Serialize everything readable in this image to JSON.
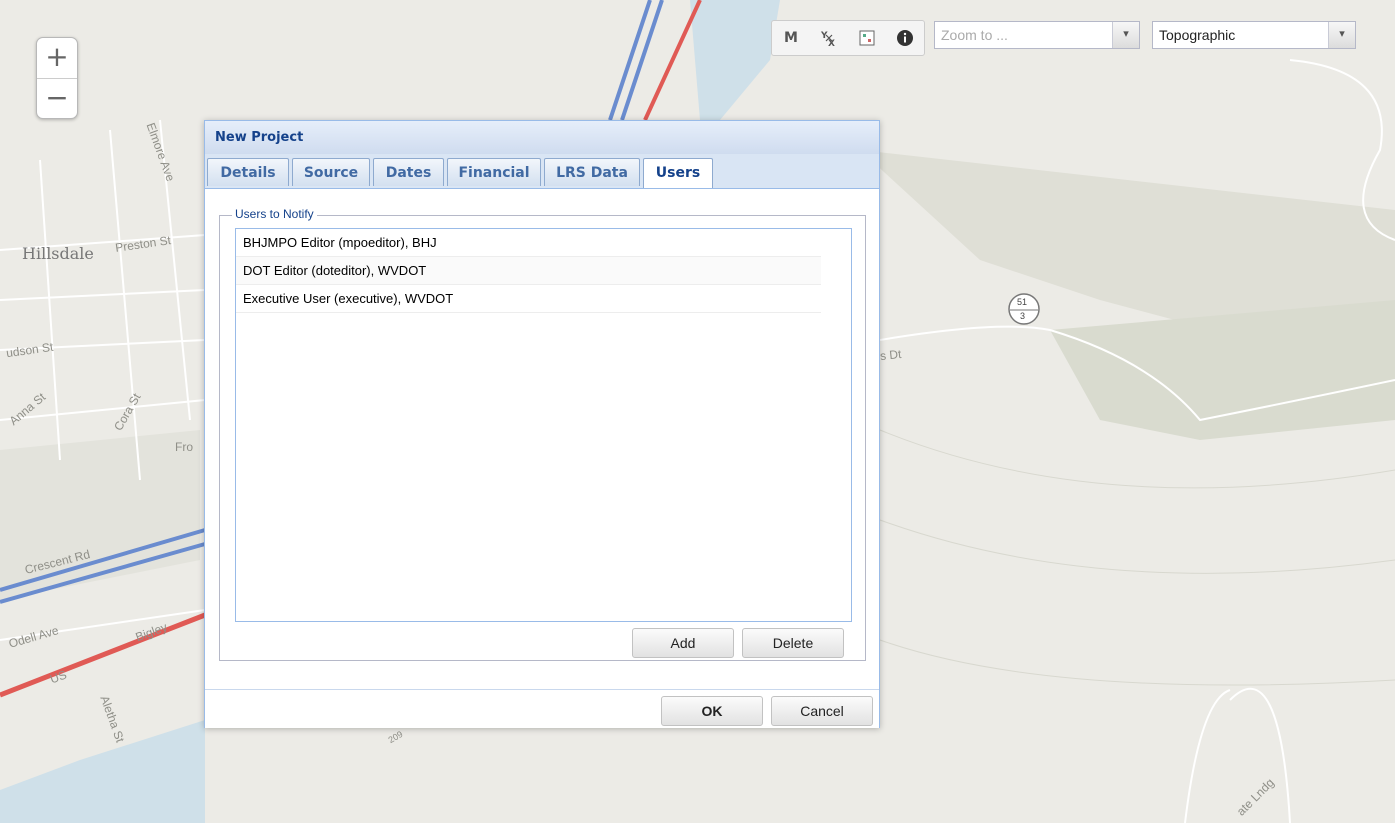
{
  "map": {
    "labels": {
      "hillsdale": "Hillsdale",
      "preston": "Preston St",
      "elmore": "Elmore Ave",
      "hudson": "udson St",
      "anna": "Anna St",
      "cora": "Cora St",
      "fro": "Fro",
      "crescent": "Crescent Rd",
      "odell": "Odell Ave",
      "us": "US",
      "bigley": "Bigley",
      "aletha": "Aletha St",
      "road_dt": "s Dt",
      "route_top": "51",
      "route_bottom": "3",
      "road_label": "209",
      "lndg": "ate Lndg"
    },
    "colors": {
      "land": "#ecebe6",
      "water": "#cfe0e9",
      "highway_blue": "#6a8ccf",
      "highway_red": "#e05a55"
    }
  },
  "zoom": {
    "in": "+",
    "out": "−"
  },
  "toolbar": {
    "measure": "M",
    "coords_icon": "coordinates-icon",
    "legend_icon": "legend-icon",
    "info_icon": "info-icon",
    "zoom_to_placeholder": "Zoom to ...",
    "basemap_value": "Topographic"
  },
  "dialog": {
    "title": "New Project",
    "tabs": [
      "Details",
      "Source",
      "Dates",
      "Financial",
      "LRS Data",
      "Users"
    ],
    "active_tab": "Users",
    "fieldset_legend": "Users to Notify",
    "users": [
      "BHJMPO Editor (mpoeditor), BHJ",
      "DOT Editor (doteditor), WVDOT",
      "Executive User (executive), WVDOT"
    ],
    "add_label": "Add",
    "delete_label": "Delete",
    "ok_label": "OK",
    "cancel_label": "Cancel"
  }
}
